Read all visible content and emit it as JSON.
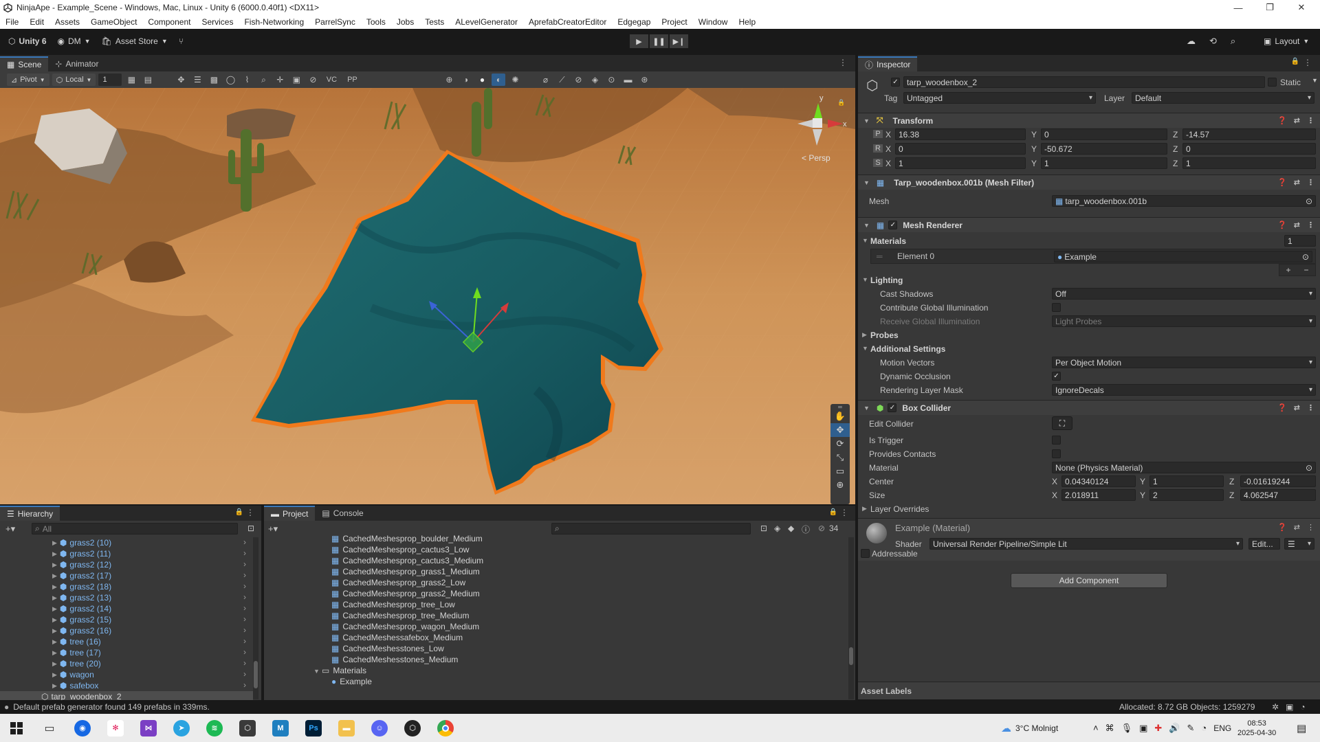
{
  "window": {
    "title": "NinjaApe - Example_Scene - Windows, Mac, Linux - Unity 6 (6000.0.40f1) <DX11>"
  },
  "menu": [
    "File",
    "Edit",
    "Assets",
    "GameObject",
    "Component",
    "Services",
    "Fish-Networking",
    "ParrelSync",
    "Tools",
    "Jobs",
    "Tests",
    "ALevelGenerator",
    "AprefabCreatorEditor",
    "Edgegap",
    "Project",
    "Window",
    "Help"
  ],
  "toolbar": {
    "unity_label": "Unity 6",
    "account_label": "DM",
    "asset_store_label": "Asset Store",
    "layout_label": "Layout"
  },
  "scene_tabs": {
    "scene": "Scene",
    "animator": "Animator"
  },
  "scene_toolbar": {
    "pivot": "Pivot",
    "local": "Local",
    "grid_step": "1",
    "vc": "VC",
    "pp": "PP",
    "persp": "< Persp",
    "axis_y": "y",
    "axis_x": "x"
  },
  "inspector": {
    "tab": "Inspector",
    "object_name": "tarp_woodenbox_2",
    "static_label": "Static",
    "tag_label": "Tag",
    "tag_value": "Untagged",
    "layer_label": "Layer",
    "layer_value": "Default",
    "transform": {
      "title": "Transform",
      "position": {
        "label": "P",
        "x": "16.38",
        "y": "0",
        "z": "-14.57"
      },
      "rotation": {
        "label": "R",
        "x": "0",
        "y": "-50.672",
        "z": "0"
      },
      "scale": {
        "label": "S",
        "x": "1",
        "y": "1",
        "z": "1"
      },
      "ax": "X",
      "ay": "Y",
      "az": "Z"
    },
    "mesh_filter": {
      "title": "Tarp_woodenbox.001b (Mesh Filter)",
      "mesh_label": "Mesh",
      "mesh_value": "tarp_woodenbox.001b"
    },
    "mesh_renderer": {
      "title": "Mesh Renderer",
      "materials_label": "Materials",
      "materials_count": "1",
      "element_label": "Element 0",
      "element_value": "Example",
      "plus": "+",
      "minus": "−",
      "lighting_label": "Lighting",
      "cast_shadows_label": "Cast Shadows",
      "cast_shadows_value": "Off",
      "contribute_gi_label": "Contribute Global Illumination",
      "receive_gi_label": "Receive Global Illumination",
      "receive_gi_value": "Light Probes",
      "probes_label": "Probes",
      "additional_label": "Additional Settings",
      "motion_vectors_label": "Motion Vectors",
      "motion_vectors_value": "Per Object Motion",
      "dynamic_occlusion_label": "Dynamic Occlusion",
      "rendering_layer_label": "Rendering Layer Mask",
      "rendering_layer_value": "IgnoreDecals"
    },
    "box_collider": {
      "title": "Box Collider",
      "edit_collider_label": "Edit Collider",
      "is_trigger_label": "Is Trigger",
      "provides_contacts_label": "Provides Contacts",
      "material_label": "Material",
      "material_value": "None (Physics Material)",
      "center_label": "Center",
      "center": {
        "x": "0.04340124",
        "y": "1",
        "z": "-0.01619244"
      },
      "size_label": "Size",
      "size": {
        "x": "2.018911",
        "y": "2",
        "z": "4.062547"
      },
      "layer_overrides_label": "Layer Overrides"
    },
    "material": {
      "title": "Example (Material)",
      "shader_label": "Shader",
      "shader_value": "Universal Render Pipeline/Simple Lit",
      "edit_label": "Edit...",
      "addressable_label": "Addressable"
    },
    "add_component": "Add Component",
    "asset_labels": "Asset Labels"
  },
  "hierarchy": {
    "tab": "Hierarchy",
    "search_placeholder": "All",
    "items": [
      "grass2 (10)",
      "grass2 (11)",
      "grass2 (12)",
      "grass2 (17)",
      "grass2 (18)",
      "grass2 (13)",
      "grass2 (14)",
      "grass2 (15)",
      "grass2 (16)",
      "tree (16)",
      "tree (17)",
      "tree (20)",
      "wagon",
      "safebox"
    ],
    "selected": "tarp_woodenbox_2"
  },
  "project": {
    "tab": "Project",
    "console_tab": "Console",
    "hidden_count": "34",
    "items": [
      "CachedMeshesprop_boulder_Medium",
      "CachedMeshesprop_cactus3_Low",
      "CachedMeshesprop_cactus3_Medium",
      "CachedMeshesprop_grass1_Medium",
      "CachedMeshesprop_grass2_Low",
      "CachedMeshesprop_grass2_Medium",
      "CachedMeshesprop_tree_Low",
      "CachedMeshesprop_tree_Medium",
      "CachedMeshesprop_wagon_Medium",
      "CachedMeshessafebox_Medium",
      "CachedMeshesstones_Low",
      "CachedMeshesstones_Medium"
    ],
    "folder": "Materials",
    "folder_child": "Example"
  },
  "status": {
    "message": "Default prefab generator found 149 prefabs in 339ms.",
    "allocated": "Allocated: 8.72 GB Objects: 1259279"
  },
  "taskbar": {
    "weather": "3°C  Molnigt",
    "lang": "ENG",
    "time": "08:53",
    "date": "2025-04-30"
  },
  "colors": {
    "accent": "#3a79bb",
    "tarp": "#1a5f64",
    "selection_outline": "#f07a1c",
    "sand": "#c88a4c"
  }
}
